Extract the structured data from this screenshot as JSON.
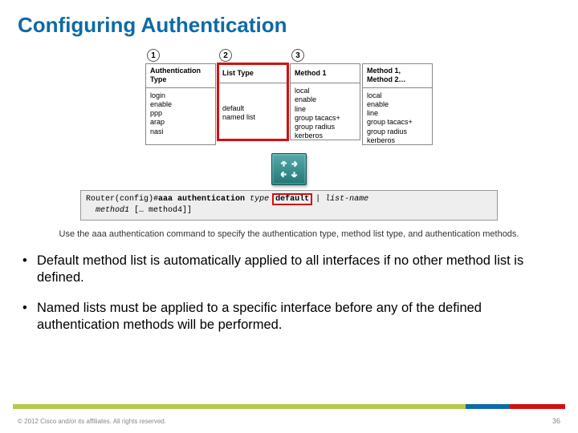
{
  "title": "Configuring Authentication",
  "columns": [
    {
      "num": "1",
      "header": "Authentication Type",
      "items": [
        "login",
        "enable",
        "ppp",
        "arap",
        "nasi"
      ],
      "highlight": false
    },
    {
      "num": "2",
      "header": "List Type",
      "items": [
        "default",
        "named list"
      ],
      "highlight": true
    },
    {
      "num": "3",
      "header": "Method 1",
      "items": [
        "local",
        "enable",
        "line",
        "group tacacs+",
        "group radius",
        "kerberos"
      ],
      "highlight": false
    },
    {
      "num": "",
      "header": "Method 1, Method 2…",
      "items": [
        "local",
        "enable",
        "line",
        "group tacacs+",
        "group radius",
        "kerberos"
      ],
      "highlight": false
    }
  ],
  "cmd": {
    "prompt": "Router(config)#",
    "p1": "aaa authentication",
    "p2": "type",
    "p3": "default",
    "sep": "|",
    "p4": "list-name",
    "line2a": "method1",
    "line2b": "[… method4]]"
  },
  "caption": "Use the aaa authentication command to specify the authentication type, method list type, and authentication methods.",
  "bullets": [
    "Default method list is automatically applied to all interfaces if no other method list is defined.",
    "Named lists must be applied to a specific interface before any of the defined authentication methods will be performed."
  ],
  "footer": "© 2012 Cisco and/or its affiliates. All rights reserved.",
  "page": "36"
}
